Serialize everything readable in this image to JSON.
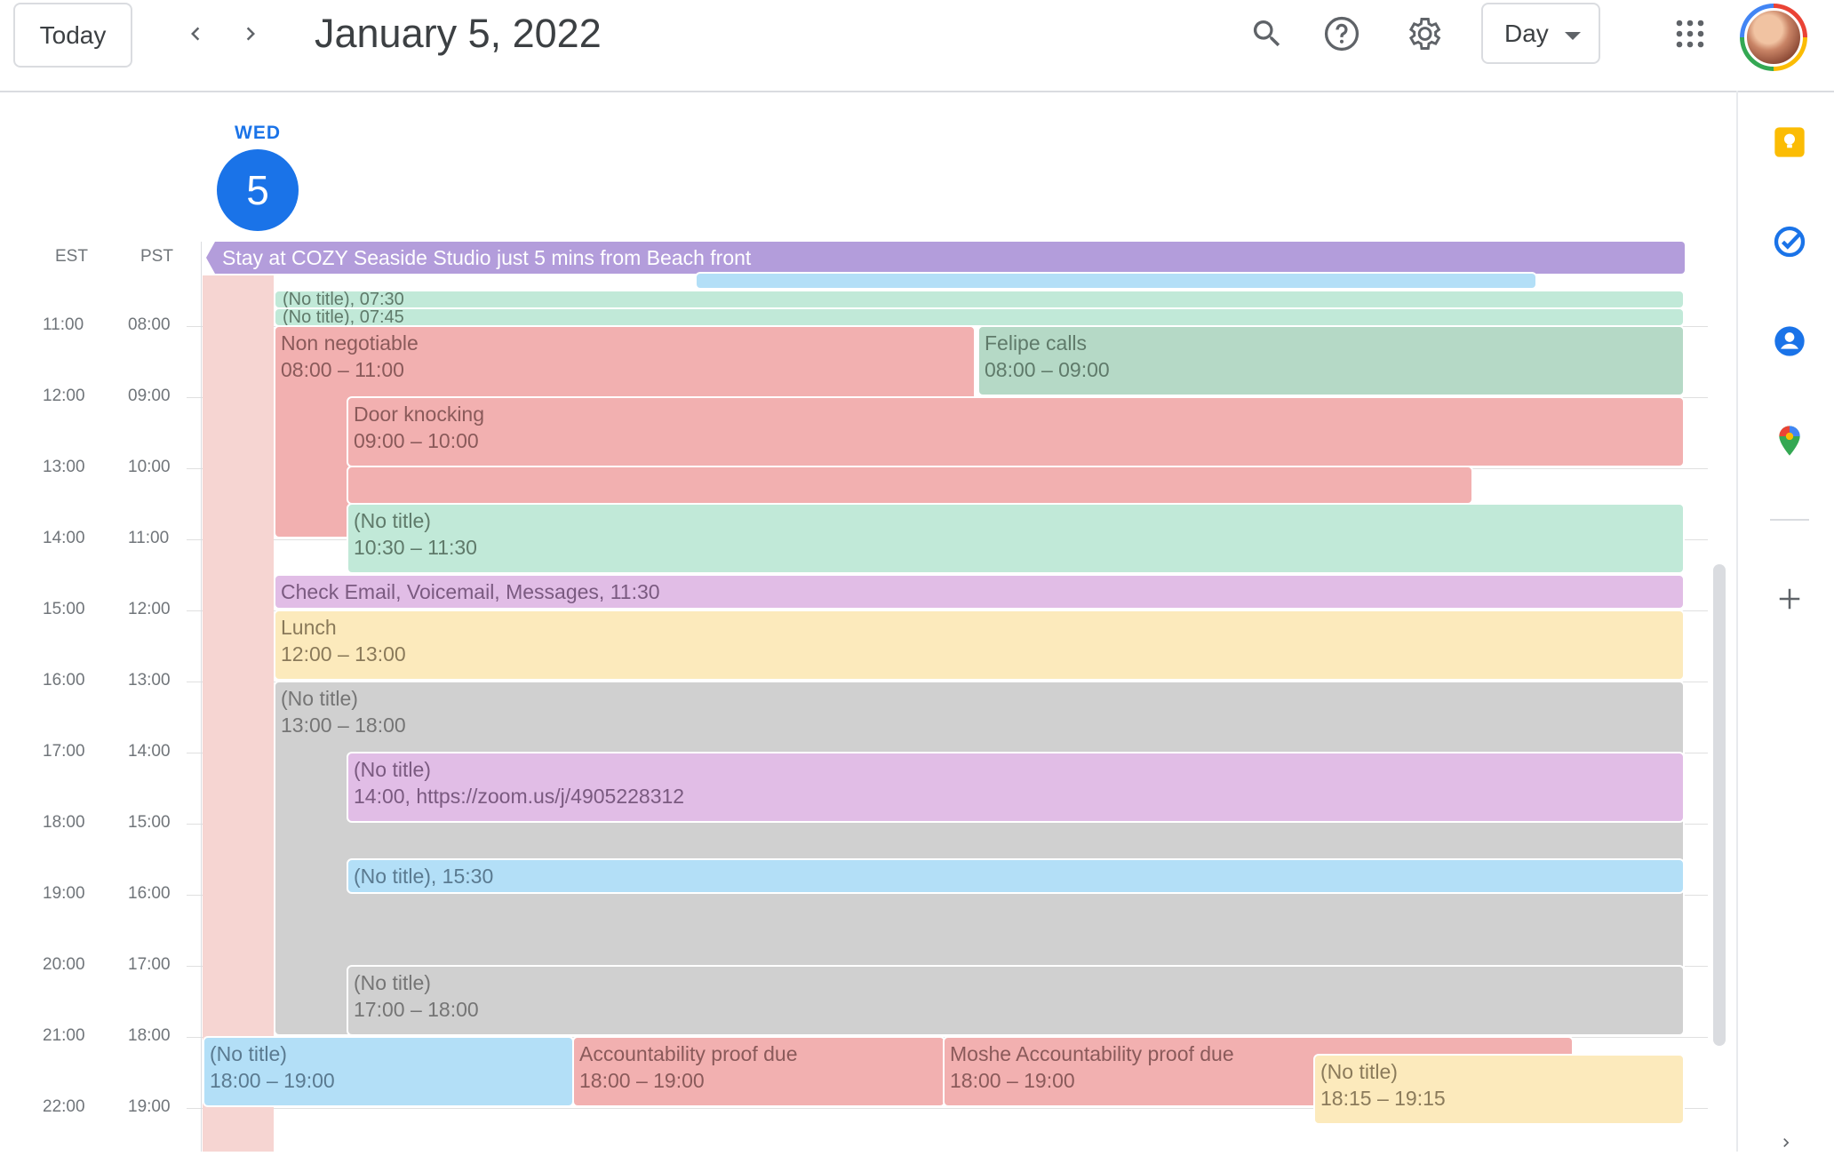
{
  "header": {
    "today_label": "Today",
    "prev_label": "‹",
    "next_label": "›",
    "date_title": "January 5, 2022",
    "view_label": "Day",
    "icons": [
      "search-icon",
      "help-icon",
      "settings-icon",
      "apps-grid-icon",
      "account-avatar"
    ]
  },
  "day": {
    "dow": "WED",
    "num": "5"
  },
  "timezones": {
    "primary": "EST",
    "secondary": "PST"
  },
  "allday_event": "Stay at COZY Seaside Studio just 5 mins from Beach front",
  "hours": [
    {
      "est": "11:00",
      "pst": "08:00"
    },
    {
      "est": "12:00",
      "pst": "09:00"
    },
    {
      "est": "13:00",
      "pst": "10:00"
    },
    {
      "est": "14:00",
      "pst": "11:00"
    },
    {
      "est": "15:00",
      "pst": "12:00"
    },
    {
      "est": "16:00",
      "pst": "13:00"
    },
    {
      "est": "17:00",
      "pst": "14:00"
    },
    {
      "est": "18:00",
      "pst": "15:00"
    },
    {
      "est": "19:00",
      "pst": "16:00"
    },
    {
      "est": "20:00",
      "pst": "17:00"
    },
    {
      "est": "21:00",
      "pst": "18:00"
    },
    {
      "est": "22:00",
      "pst": "19:00"
    }
  ],
  "events": {
    "notitle_0730": {
      "title": "(No title)",
      "time": ", 07:30"
    },
    "notitle_0745": {
      "title": "(No title)",
      "time": ", 07:45"
    },
    "non_negotiable": {
      "title": "Non negotiable",
      "time": "08:00 – 11:00"
    },
    "felipe_calls": {
      "title": "Felipe calls",
      "time": "08:00 – 09:00"
    },
    "door_knocking": {
      "title": "Door knocking",
      "time": "09:00 – 10:00"
    },
    "notitle_1030": {
      "title": "(No title)",
      "time": "10:30 – 11:30"
    },
    "check_email": {
      "title": "Check Email, Voicemail, Messages",
      "time": ", 11:30"
    },
    "lunch": {
      "title": "Lunch",
      "time": "12:00 – 13:00"
    },
    "notitle_1300": {
      "title": "(No title)",
      "time": "13:00 – 18:00"
    },
    "notitle_1400": {
      "title": "(No title)",
      "time": "14:00, https://zoom.us/j/4905228312"
    },
    "notitle_1530": {
      "title": "(No title)",
      "time": ", 15:30"
    },
    "notitle_1700": {
      "title": "(No title)",
      "time": "17:00 – 18:00"
    },
    "notitle_1800": {
      "title": "(No title)",
      "time": "18:00 – 19:00"
    },
    "accountability": {
      "title": "Accountability proof due",
      "time": "18:00 – 19:00"
    },
    "moshe_accountability": {
      "title": "Moshe Accountability proof due",
      "time": "18:00 – 19:00"
    },
    "notitle_1815": {
      "title": "(No title)",
      "time": "18:15 – 19:15"
    }
  },
  "colors": {
    "accent": "#1a73e8",
    "allday": "#b39ddb"
  },
  "side_panel": [
    "keep-icon",
    "tasks-icon",
    "contacts-icon",
    "maps-icon",
    "add-icon"
  ]
}
